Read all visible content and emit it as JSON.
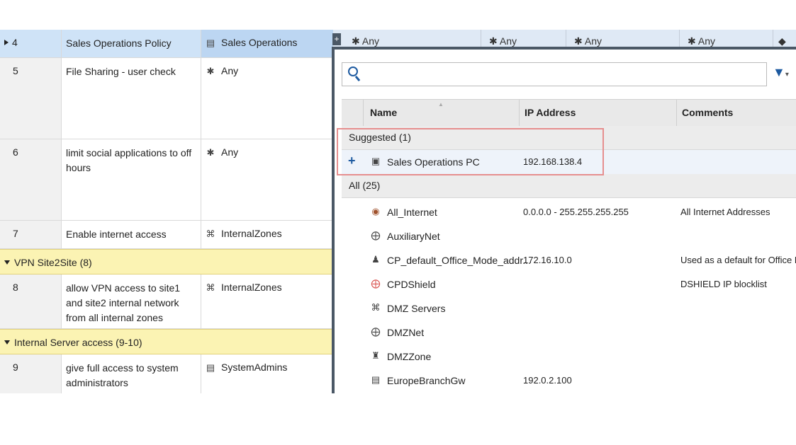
{
  "policy_rows": [
    {
      "num": "4",
      "name": "Sales Operations Policy",
      "source": "Sales Operations",
      "source_icon": "group-icon",
      "selected": true
    },
    {
      "num": "5",
      "name": "File Sharing - user check",
      "source": "Any",
      "source_icon": "asterisk-icon"
    },
    {
      "num": "6",
      "name": "limit social applications to off hours",
      "source": "Any",
      "source_icon": "asterisk-icon"
    },
    {
      "num": "7",
      "name": "Enable internet access",
      "source": "InternalZones",
      "source_icon": "zones-icon"
    },
    {
      "num": "8",
      "name": "allow VPN access to site1 and site2 internal network from all internal zones",
      "source": "InternalZones",
      "source_icon": "zones-icon"
    },
    {
      "num": "9",
      "name": "give full access to system administrators",
      "source": "SystemAdmins",
      "source_icon": "group-icon"
    }
  ],
  "sections": [
    {
      "label": "VPN Site2Site (8)"
    },
    {
      "label": "Internal Server access (9-10)"
    }
  ],
  "top_strip": [
    "Any",
    "Any",
    "Any",
    "Any"
  ],
  "popup": {
    "search_placeholder": "",
    "columns": {
      "name": "Name",
      "ip": "IP Address",
      "comments": "Comments"
    },
    "suggested_label": "Suggested (1)",
    "suggested": [
      {
        "name": "Sales Operations PC",
        "ip": "192.168.138.4",
        "comments": "",
        "icon": "host-icon"
      }
    ],
    "all_label": "All (25)",
    "items": [
      {
        "name": "All_Internet",
        "ip": "0.0.0.0 - 255.255.255.255",
        "comments": "All Internet Addresses",
        "icon": "address-range-icon"
      },
      {
        "name": "AuxiliaryNet",
        "ip": "",
        "comments": "",
        "icon": "network-icon"
      },
      {
        "name": "CP_default_Office_Mode_addr...",
        "ip": "172.16.10.0",
        "comments": "Used as a default for Office M",
        "icon": "office-mode-icon"
      },
      {
        "name": "CPDShield",
        "ip": "",
        "comments": "DSHIELD IP blocklist",
        "icon": "dshield-icon"
      },
      {
        "name": "DMZ Servers",
        "ip": "",
        "comments": "",
        "icon": "zones-icon"
      },
      {
        "name": "DMZNet",
        "ip": "",
        "comments": "",
        "icon": "network-icon"
      },
      {
        "name": "DMZZone",
        "ip": "",
        "comments": "",
        "icon": "zone-icon"
      },
      {
        "name": "EuropeBranchGw",
        "ip": "192.0.2.100",
        "comments": "",
        "icon": "gateway-icon"
      }
    ]
  },
  "colors": {
    "accent": "#1d5aa0",
    "section_bg": "#fbf3b3",
    "selected_row": "#cfe3f7",
    "highlight_border": "#e68f8f"
  }
}
